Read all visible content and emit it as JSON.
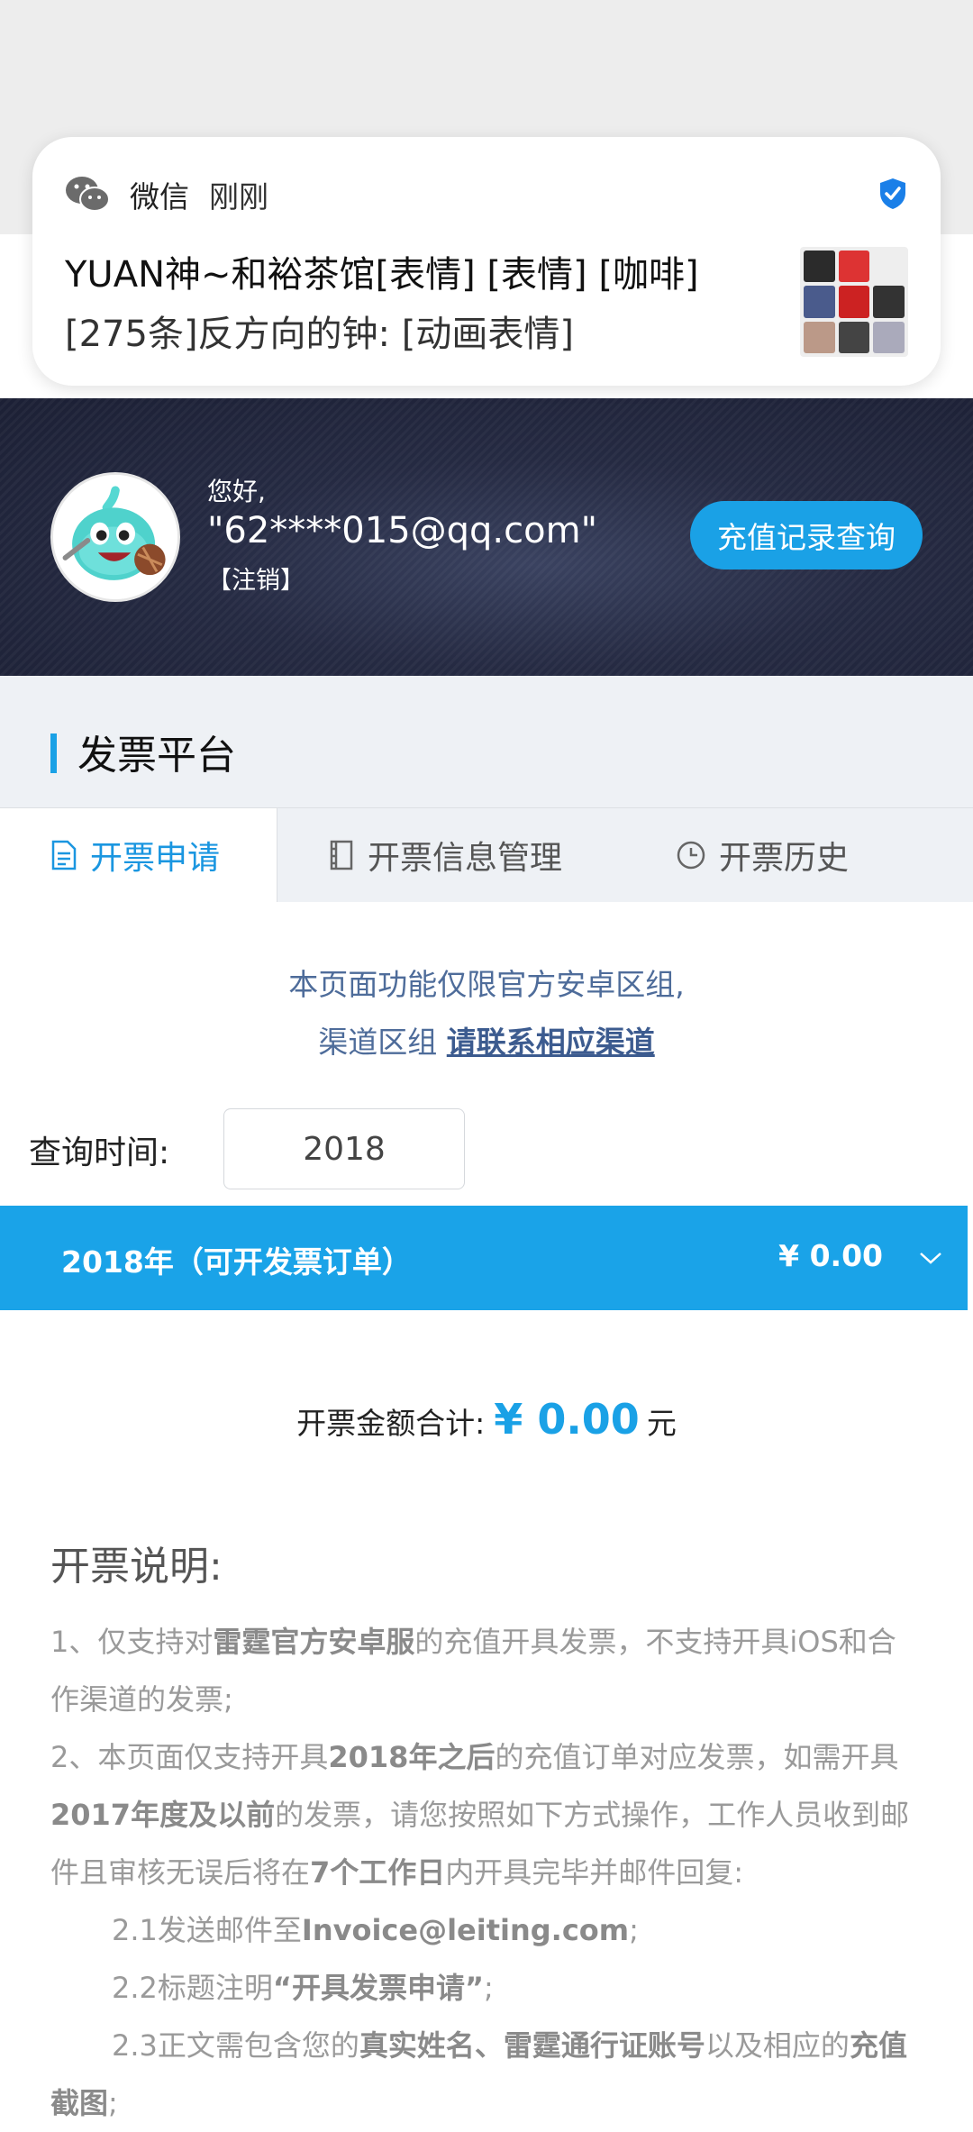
{
  "notification": {
    "app": "微信",
    "time": "刚刚",
    "title": "YUAN神~和裕茶馆[表情] [表情] [咖啡]",
    "body": "[275条]反方向的钟: [动画表情]",
    "thumb_colors": [
      "#2b2b2b",
      "#d33",
      "#eee",
      "#4a5b8c",
      "#c22",
      "#333",
      "#b98",
      "#444",
      "#aab"
    ]
  },
  "user": {
    "greeting": "您好,",
    "account": "\"62****015@qq.com\"",
    "logout": "【注销】",
    "recharge_button": "充值记录查询"
  },
  "platform": {
    "title": "发票平台"
  },
  "tabs": [
    {
      "label": "开票申请",
      "icon": "document-icon"
    },
    {
      "label": "开票信息管理",
      "icon": "ledger-icon"
    },
    {
      "label": "开票历史",
      "icon": "clock-icon"
    }
  ],
  "notice": {
    "line1": "本页面功能仅限官方安卓区组,",
    "line2_prefix": "渠道区组 ",
    "line2_link": "请联系相应渠道"
  },
  "query": {
    "label": "查询时间:",
    "year": "2018"
  },
  "year_bar": {
    "label": "2018年（可开发票订单）",
    "amount": "¥ 0.00"
  },
  "total": {
    "label": "开票金额合计:",
    "amount": "¥ 0.00",
    "unit": "元"
  },
  "instructions": {
    "title": "开票说明:",
    "p1": [
      "1、仅支持对",
      "雷霆官方安卓服",
      "的充值开具发票，不支持开具iOS和合作渠道的发票;"
    ],
    "p2": [
      "2、本页面仅支持开具",
      "2018年之后",
      "的充值订单对应发票，如需开具",
      "2017年度及以前",
      "的发票，请您按照如下方式操作，工作人员收到邮件且审核无误后将在",
      "7个工作日",
      "内开具完毕并邮件回复:"
    ],
    "p21": [
      "2.1发送邮件至",
      "Invoice@leiting.com",
      ";"
    ],
    "p22": [
      "2.2标题注明",
      "“开具发票申请”",
      ";"
    ],
    "p23": [
      "2.3正文需包含您的",
      "真实姓名、雷霆通行证账号",
      "以及相应的",
      "充值截图",
      ";"
    ]
  }
}
